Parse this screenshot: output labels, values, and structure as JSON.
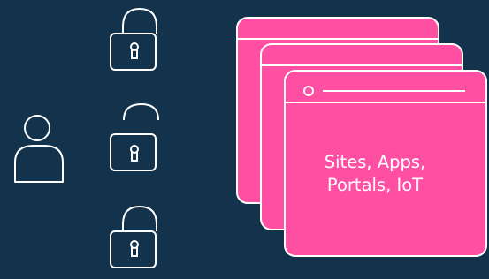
{
  "colors": {
    "background": "#13324b",
    "window_fill": "#ff4fa3",
    "stroke": "#ffffff"
  },
  "icons": {
    "user": "user-icon",
    "locked": "padlock-locked-icon",
    "unlocked": "padlock-unlocked-icon",
    "windows": "browser-window-icon"
  },
  "window_caption": {
    "line1": "Sites, Apps,",
    "line2": "Portals, IoT"
  }
}
